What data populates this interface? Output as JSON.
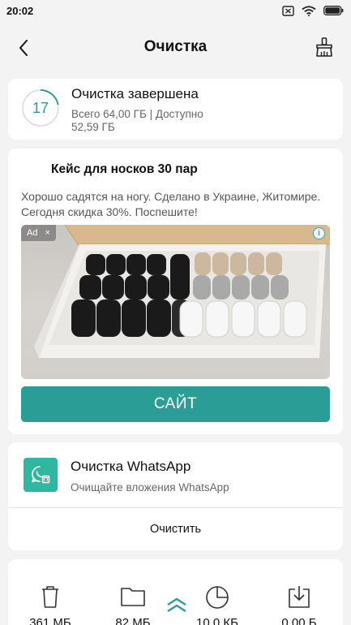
{
  "status_bar": {
    "time": "20:02",
    "icons": [
      "sim-off-icon",
      "wifi-icon",
      "battery-icon"
    ]
  },
  "app_bar": {
    "title": "Очистка",
    "left_icon": "back-arrow-icon",
    "right_icon": "broom-icon"
  },
  "storage": {
    "ring_value": "17",
    "title": "Очистка завершена",
    "subtitle": "Всего 64,00 ГБ | Доступно 52,59 ГБ"
  },
  "ad": {
    "headline": "Кейс для носков 30 пар",
    "body": "Хорошо садятся на ногу. Сделано в Украине, Житомире. Сегодня скидка 30%. Поспешите!",
    "ad_label": "Ad",
    "ad_close": "×",
    "info_label": "i",
    "cta_label": "САЙТ",
    "image_icon": "sock-box-image"
  },
  "whatsapp": {
    "title": "Очистка WhatsApp",
    "subtitle": "Очищайте вложения WhatsApp",
    "action_label": "Очистить",
    "icon": "whatsapp-clean-icon"
  },
  "stats": [
    {
      "icon": "trash-icon",
      "value": "361 МБ"
    },
    {
      "icon": "folder-icon",
      "value": "82 МБ"
    },
    {
      "icon": "pie-chart-icon",
      "value": "10,0 КБ"
    },
    {
      "icon": "download-icon",
      "value": "0,00 Б"
    }
  ],
  "colors": {
    "accent": "#2a9d96",
    "background": "#f3f3f3",
    "card": "#ffffff",
    "secondary_text": "#666666"
  }
}
